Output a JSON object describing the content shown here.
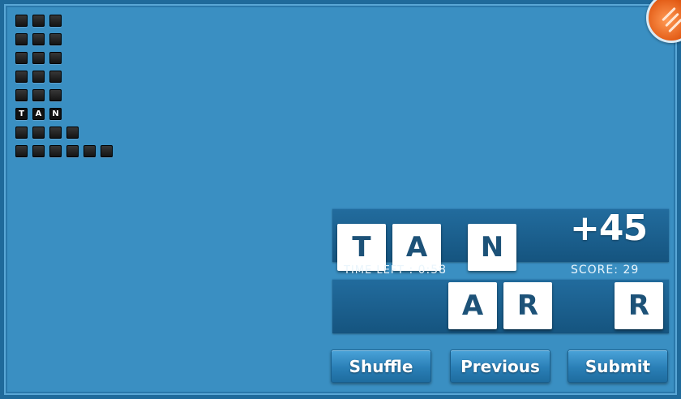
{
  "word_grid": {
    "rows": [
      [
        "",
        "",
        ""
      ],
      [
        "",
        "",
        ""
      ],
      [
        "",
        "",
        ""
      ],
      [
        "",
        "",
        ""
      ],
      [
        "",
        "",
        ""
      ],
      [
        "T",
        "A",
        "N"
      ],
      [
        "",
        "",
        "",
        ""
      ],
      [
        "",
        "",
        "",
        "",
        "",
        ""
      ]
    ]
  },
  "current_word": {
    "tiles": [
      "T",
      "A",
      "N"
    ]
  },
  "letter_rack": {
    "tiles": [
      "A",
      "R",
      "R"
    ]
  },
  "points_popup": "+45",
  "status": {
    "time_left_label": "Time Left",
    "time_left_sep": ":",
    "time_left_value": "0:58",
    "score_label": "SCORE:",
    "score_value": "29"
  },
  "buttons": {
    "shuffle": "Shuffle",
    "previous": "Previous",
    "submit": "Submit"
  },
  "colors": {
    "background": "#3a8fc2",
    "panel": "#1a5e8b",
    "tile": "#ffffff",
    "tile_text": "#1d5278",
    "badge": "#e25a14"
  },
  "icons": {
    "corner": "menu-stripes-icon"
  }
}
